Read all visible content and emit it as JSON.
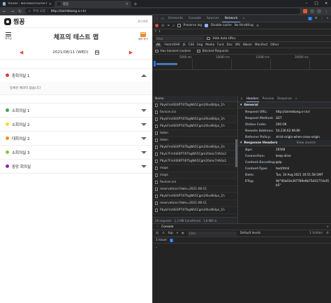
{
  "browser": {
    "tabs": [
      {
        "title": "Issues · wecowo/course-team-2021"
      },
      {
        "title": "찜꽁"
      }
    ],
    "security_label": "주의 요함",
    "url": "http://zzimkkong.o-r.kr"
  },
  "page": {
    "brand": "찜꽁",
    "logout": "로그아웃",
    "menu_label": "회의실",
    "title": "체프의 테스트 맵",
    "book_label": "예약 하기",
    "date": "2021/08/11 (WED)",
    "rooms": [
      {
        "name": "중회의실 1",
        "color": "#e53935",
        "expanded": true,
        "empty_text": "등록된 예약이 없습니다"
      },
      {
        "name": "소회의실 1",
        "color": "#43a047"
      },
      {
        "name": "소회의실 2",
        "color": "#fdd835"
      },
      {
        "name": "대회의실 2",
        "color": "#fb8c00"
      },
      {
        "name": "소회의실 3",
        "color": "#8bc34a"
      },
      {
        "name": "중앙 회의실",
        "color": "#8e24aa"
      }
    ]
  },
  "devtools": {
    "tabs": [
      "Elements",
      "Console",
      "Sources",
      "Network"
    ],
    "selected_tab": "Network",
    "badge": "1",
    "toolbar": {
      "preserve_log": "Preserve log",
      "disable_cache": "Disable cache",
      "throttle": "No throttling"
    },
    "filter": {
      "placeholder": "Filter",
      "hide_data_urls": "Hide data URLs",
      "types": [
        "All",
        "Fetch/XHR",
        "JS",
        "CSS",
        "Img",
        "Media",
        "Font",
        "Doc",
        "WS",
        "Wasm",
        "Manifest",
        "Other"
      ],
      "has_blocked_cookies": "Has blocked cookies",
      "blocked_requests": "Blocked Requests"
    },
    "timeline_ticks": [
      "5000 ms",
      "10000 ms",
      "15000 ms",
      "20000 ms"
    ],
    "requests": {
      "header": "Name",
      "rows": [
        "PbykFmXiE6PT4lTbgNA5Cgm20lxd64px_1h",
        "favicon.ico",
        "PbykFmXiE6PT4lTbgNA5Cgm20lxd64px_1h",
        "PbykFmXiE6PT4lTbgNA5Cgm20lxd64px_1h",
        "token",
        "token",
        "PbykFmXiE6PT4lTbgNA5Cgm20lxd64px_1h",
        "Pbyk7FmXiE6PT4lTbgNA5Cgm20alvi7dAGs2",
        "Pbyk7FmXiE6PT4lTbgNA5Cgm20alvi7dAGs2",
        "maps",
        "maps",
        "favicon.ico",
        "reservations?date=2021-08-11",
        "PbykFmXiE6PT4lTbgNA5Cgm20lxd64px_1h",
        "reservations?date=2021-08-11",
        "PbykFmXiE6PT4lTbgNA5Cgm20lxd64px_1h"
      ],
      "status": [
        "29 requests",
        "1.2 MB transferred",
        "1.8 MB re"
      ]
    },
    "detail": {
      "tabs": [
        "Headers",
        "Preview",
        "Response"
      ],
      "general_title": "General",
      "general": [
        {
          "k": "Request URL:",
          "v": "http://zzimkkong.o-r.kr/"
        },
        {
          "k": "Request Method:",
          "v": "GET"
        },
        {
          "k": "Status Code:",
          "v": "200 OK"
        },
        {
          "k": "Remote Address:",
          "v": "54.230.62.96:80"
        },
        {
          "k": "Referrer Policy:",
          "v": "strict-origin-when-cross-origin"
        }
      ],
      "response_title": "Response Headers",
      "view_source": "View source",
      "response": [
        {
          "k": "Age:",
          "v": "26568"
        },
        {
          "k": "Connection:",
          "v": "keep-alive"
        },
        {
          "k": "Content-Encoding:",
          "v": "gzip"
        },
        {
          "k": "Content-Type:",
          "v": "text/html"
        },
        {
          "k": "Date:",
          "v": "Tue, 10 Aug 2021 16:51:58 GMT"
        },
        {
          "k": "ETag:",
          "v": "W/\"00a03e307789e6b75d3177cb35b5\""
        }
      ]
    },
    "console": {
      "tab": "Console",
      "context": "top",
      "filter_placeholder": "Filter",
      "levels": "Default levels",
      "hidden": "1 hidden",
      "issue_text": "1 Issue:",
      "issue_count": "1",
      "prompt": "›"
    }
  }
}
